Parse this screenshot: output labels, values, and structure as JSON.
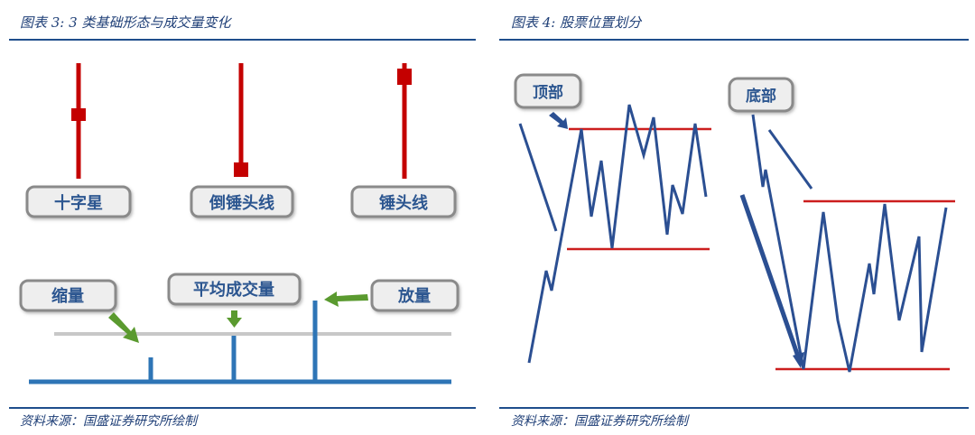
{
  "left_panel": {
    "title": "图表 3:  3 类基础形态与成交量变化",
    "source": "资料来源：国盛证券研究所绘制",
    "candle_labels": [
      "十字星",
      "倒锤头线",
      "锤头线"
    ],
    "volume_labels": {
      "shrink": "缩量",
      "average": "平均成交量",
      "expand": "放量"
    },
    "colors": {
      "candle": "#c40000",
      "volume": "#2e75b6",
      "arrow": "#5a9a2f",
      "avg_line": "#c8c8c8"
    }
  },
  "right_panel": {
    "title": "图表 4:  股票位置划分",
    "source": "资料来源：国盛证券研究所绘制",
    "top_label": "顶部",
    "bottom_label": "底部",
    "colors": {
      "price": "#2b4f92",
      "band": "#cc1e1e"
    }
  }
}
